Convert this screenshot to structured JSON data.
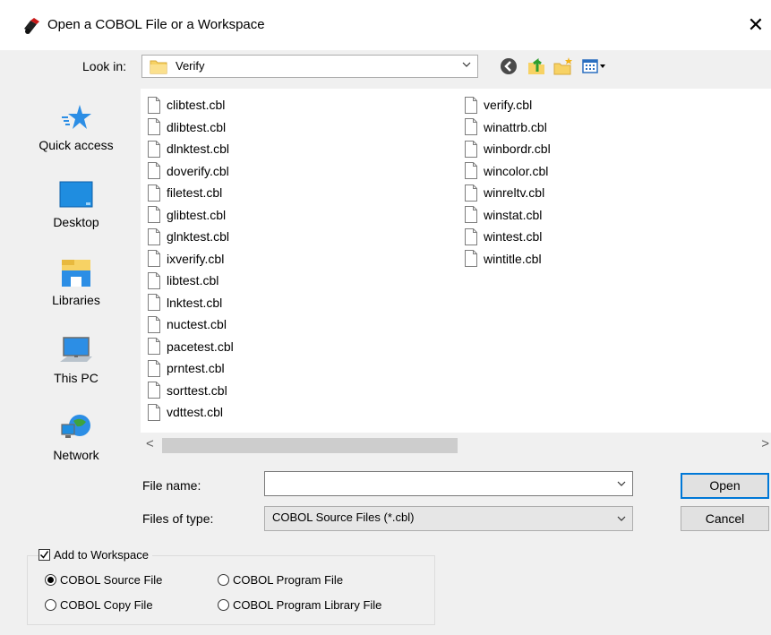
{
  "window": {
    "title": "Open a COBOL File or a Workspace",
    "close_symbol": "✕"
  },
  "lookin": {
    "label": "Look in:",
    "value": "Verify"
  },
  "toolbar": {
    "icons": [
      "back-icon",
      "up-folder-icon",
      "new-folder-icon",
      "view-menu-icon"
    ]
  },
  "places": [
    {
      "label": "Quick access",
      "icon": "quick-access-star-icon"
    },
    {
      "label": "Desktop",
      "icon": "desktop-icon"
    },
    {
      "label": "Libraries",
      "icon": "libraries-icon"
    },
    {
      "label": "This PC",
      "icon": "this-pc-icon"
    },
    {
      "label": "Network",
      "icon": "network-icon"
    }
  ],
  "files": {
    "column1": [
      "clibtest.cbl",
      "dlibtest.cbl",
      "dlnktest.cbl",
      "doverify.cbl",
      "filetest.cbl",
      "glibtest.cbl",
      "glnktest.cbl",
      "ixverify.cbl",
      "libtest.cbl",
      "lnktest.cbl",
      "nuctest.cbl",
      "pacetest.cbl",
      "prntest.cbl",
      "sorttest.cbl",
      "vdttest.cbl"
    ],
    "column2": [
      "verify.cbl",
      "winattrb.cbl",
      "winbordr.cbl",
      "wincolor.cbl",
      "winreltv.cbl",
      "winstat.cbl",
      "wintest.cbl",
      "wintitle.cbl"
    ]
  },
  "scroll": {
    "left_arrow": "<",
    "right_arrow": ">"
  },
  "filename": {
    "label": "File name:",
    "value": ""
  },
  "filetype": {
    "label": "Files of type:",
    "value": "COBOL Source Files (*.cbl)"
  },
  "buttons": {
    "open": "Open",
    "cancel": "Cancel"
  },
  "workspace": {
    "checkbox_label": "Add to Workspace",
    "checked": true,
    "options": [
      {
        "label": "COBOL Source File",
        "selected": true
      },
      {
        "label": "COBOL Program File",
        "selected": false
      },
      {
        "label": "COBOL Copy File",
        "selected": false
      },
      {
        "label": "COBOL Program Library File",
        "selected": false
      }
    ]
  }
}
